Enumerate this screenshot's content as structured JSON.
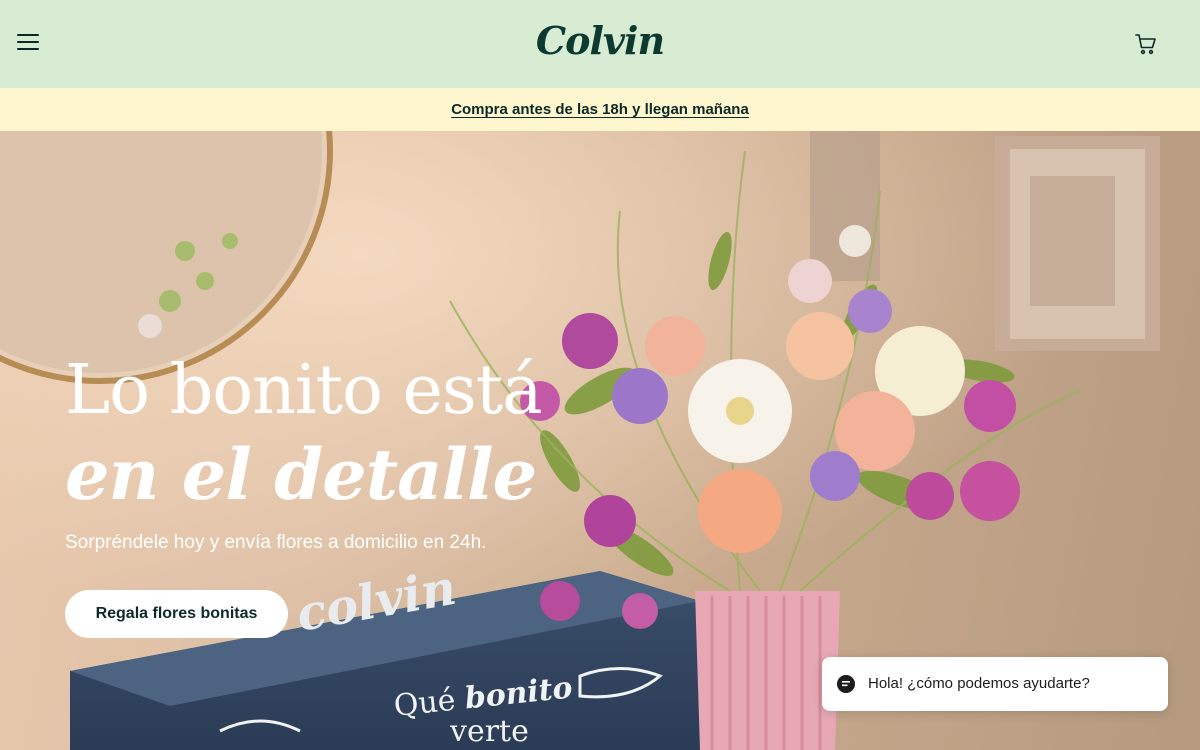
{
  "header": {
    "logo": "Colvin",
    "menu_icon": "hamburger-menu-icon",
    "cart_icon": "shopping-cart-icon",
    "background_color": "#d7ecd3"
  },
  "promo": {
    "text": "Compra antes de las 18h y llegan mañana",
    "background_color": "#fdf6cf"
  },
  "hero": {
    "title_line1": "Lo bonito está",
    "title_line2": "en el detalle",
    "subtitle": "Sorpréndele hoy y envía flores a domicilio en 24h.",
    "cta_label": "Regala flores bonitas",
    "box_brand": "colvin",
    "box_text_line1_regular": "Qué",
    "box_text_line1_italic": "bonito",
    "box_text_line2": "verte"
  },
  "chat": {
    "icon": "chat-bubble-icon",
    "text": "Hola! ¿cómo podemos ayudarte?"
  }
}
